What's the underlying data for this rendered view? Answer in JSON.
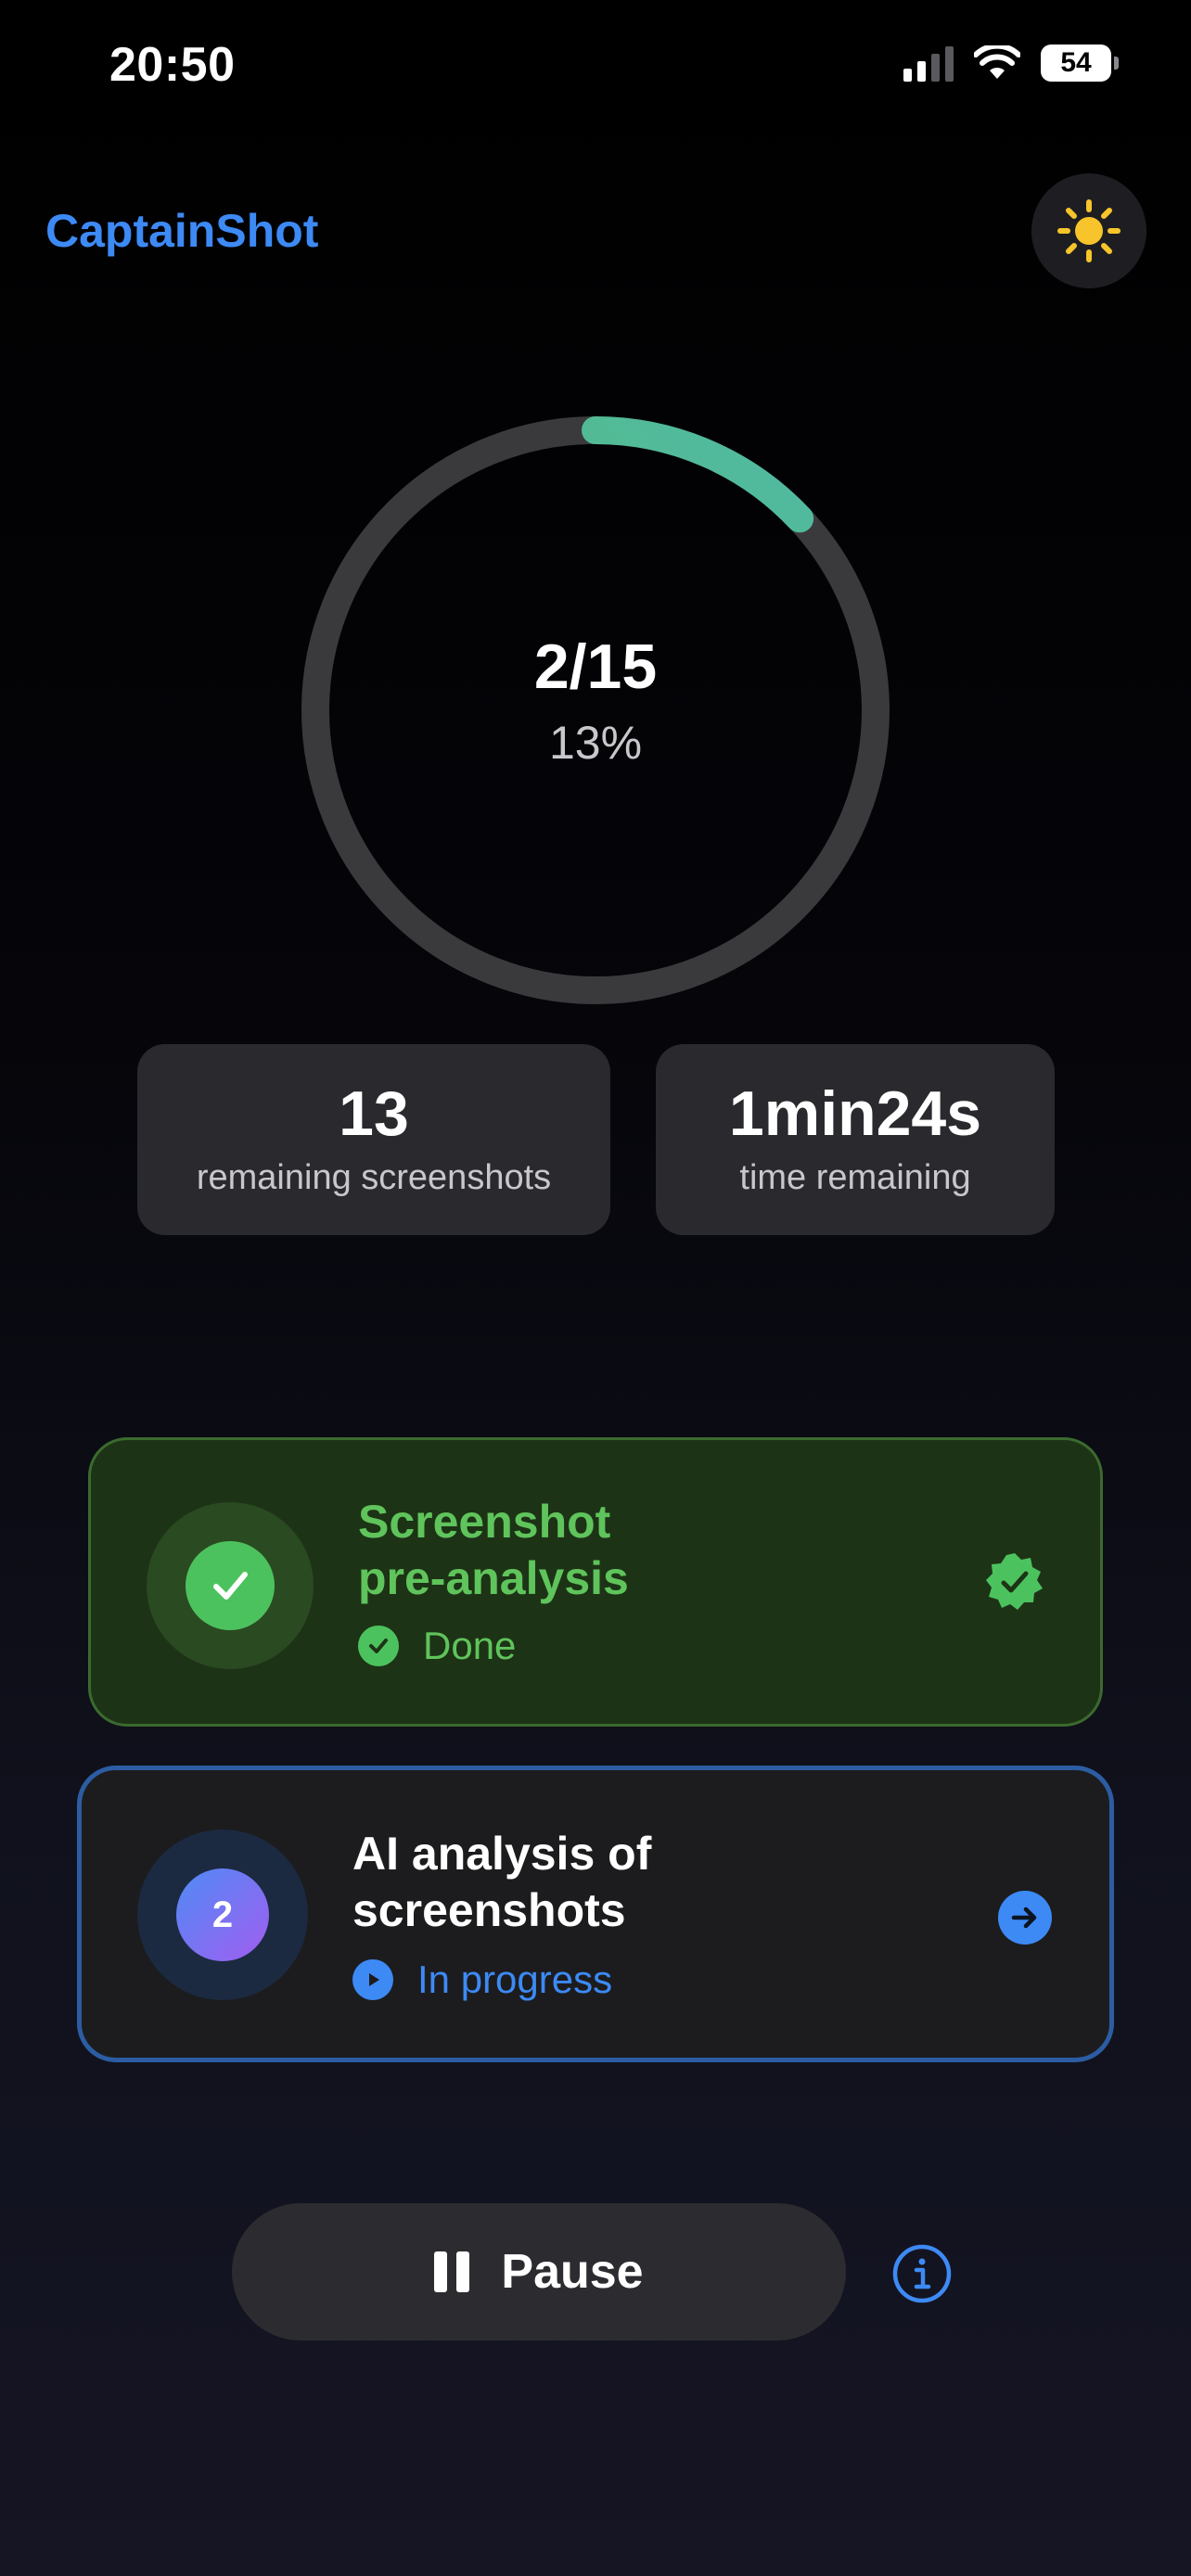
{
  "status_bar": {
    "time": "20:50",
    "battery": "54"
  },
  "header": {
    "title": "CaptainShot"
  },
  "progress": {
    "count": "2/15",
    "percent": "13%",
    "fraction": 0.13
  },
  "stats": [
    {
      "value": "13",
      "label": "remaining screenshots"
    },
    {
      "value": "1min24s",
      "label": "time remaining"
    }
  ],
  "steps": [
    {
      "title_line1": "Screenshot",
      "title_line2": "pre-analysis",
      "status": "Done"
    },
    {
      "number": "2",
      "title_line1": "AI analysis of",
      "title_line2": "screenshots",
      "status": "In progress"
    }
  ],
  "controls": {
    "pause_label": "Pause"
  },
  "colors": {
    "accent_blue": "#3d8af5",
    "success_green": "#5fc45b",
    "ring_track": "#3a3a3c",
    "ring_start": "#5cc45e",
    "ring_end": "#4fb8a8",
    "sun_yellow": "#f7c52b"
  },
  "icons": {
    "theme": "sun-icon",
    "step1_badge": "check-icon",
    "step1_trail": "verified-seal-icon",
    "step2_trail": "arrow-right-icon",
    "info": "info-icon",
    "pause": "pause-icon"
  }
}
